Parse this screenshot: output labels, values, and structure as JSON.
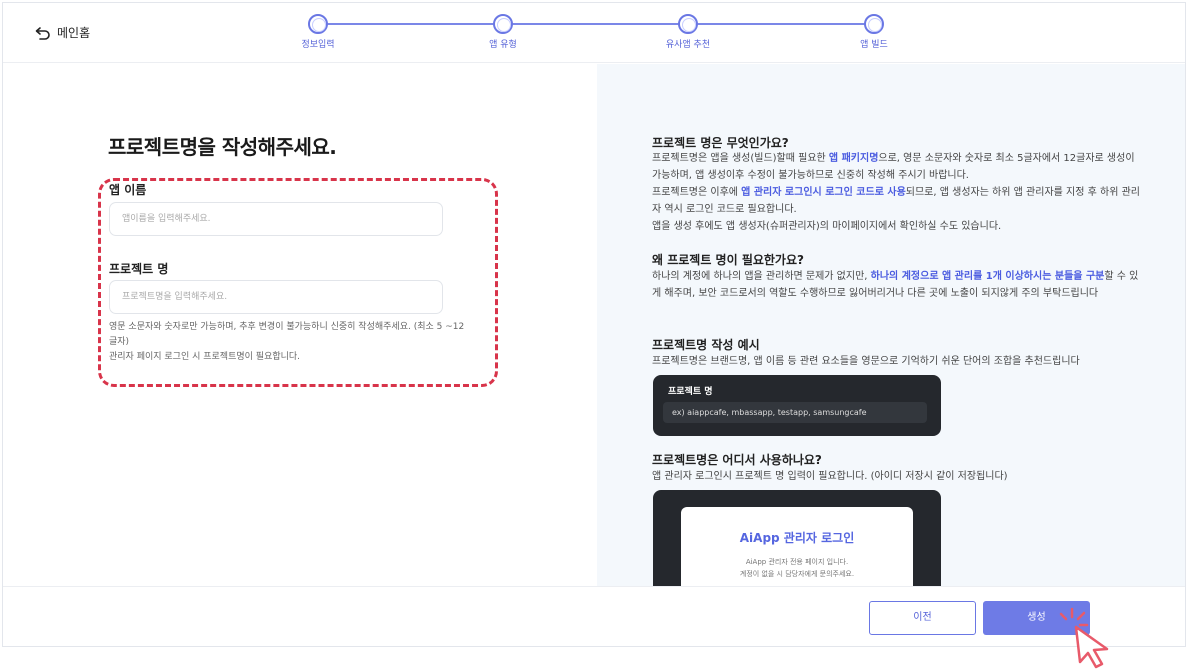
{
  "header": {
    "home_label": "메인홈",
    "steps": [
      {
        "label": "정보입력"
      },
      {
        "label": "앱 유형"
      },
      {
        "label": "유사앱 추천"
      },
      {
        "label": "앱 빌드"
      }
    ]
  },
  "form": {
    "title": "프로젝트명을 작성해주세요.",
    "app_name_label": "앱 이름",
    "app_name_placeholder": "앱이름을 입력해주세요.",
    "project_name_label": "프로젝트 명",
    "project_name_placeholder": "프로젝트명을 입력해주세요.",
    "hint_line1": "영문 소문자와 숫자로만 가능하며, 추후 변경이 불가능하니 신중히 작성해주세요. (최소 5 ~12글자)",
    "hint_line2": "관리자 페이지 로그인 시 프로젝트명이 필요합니다."
  },
  "info": {
    "s1_title": "프로젝트 명은 무엇인가요?",
    "s1_p1_a": "프로젝트명은 앱을 생성(빌드)할때 필요한 ",
    "s1_p1_b": "앱 패키지명",
    "s1_p1_c": "으로, 영문 소문자와 숫자로 최소 5글자에서 12글자로 생성이 가능하며, 앱 생성이후 수정이 불가능하므로 신중히 작성해 주시기 바랍니다.",
    "s1_p2_a": "프로젝트명은 이후에 ",
    "s1_p2_b": "앱 관리자 로그인시 로그인 코드로 사용",
    "s1_p2_c": "되므로, 앱 생성자는 하위 앱 관리자를 지정 후 하위 관리자 역시 로그인 코드로 필요합니다.",
    "s1_p3": "앱을 생성 후에도 앱 생성자(슈퍼관리자)의 마이페이지에서 확인하실 수도 있습니다.",
    "s2_title": "왜 프로젝트 명이 필요한가요?",
    "s2_p_a": "하나의 계정에 하나의 앱을 관리하면 문제가 없지만, ",
    "s2_p_b": "하나의 계정으로 앱 관리를 1개 이상하시는 분들을 구분",
    "s2_p_c": "할 수 있게 해주며, 보안 코드로서의 역할도 수행하므로 잃어버리거나 다른 곳에 노출이 되지않게 주의 부탁드립니다",
    "s3_title": "프로젝트명 작성 예시",
    "s3_p": "프로젝트명은 브랜드명, 앱 이름 등 관련 요소들을 영문으로 기억하기 쉬운 단어의 조합을 추천드립니다",
    "example_label": "프로젝트 명",
    "example_value": "ex) aiappcafe, mbassapp, testapp, samsungcafe",
    "s4_title": "프로젝트명은 어디서 사용하나요?",
    "s4_p": "앱 관리자 로그인시 프로젝트 명 입력이 필요합니다. (아이디 저장시 같이 저장됩니다)",
    "login_title": "AiApp 관리자 로그인",
    "login_sub1": "AiApp 관리자 전용 페이지 입니다.",
    "login_sub2": "계정이 없을 시 담당자에게 문의주세요."
  },
  "footer": {
    "prev_label": "이전",
    "create_label": "생성"
  },
  "colors": {
    "accent": "#6e7be6",
    "highlight_border": "#d8344a",
    "right_panel_bg": "#f4f8fc"
  }
}
